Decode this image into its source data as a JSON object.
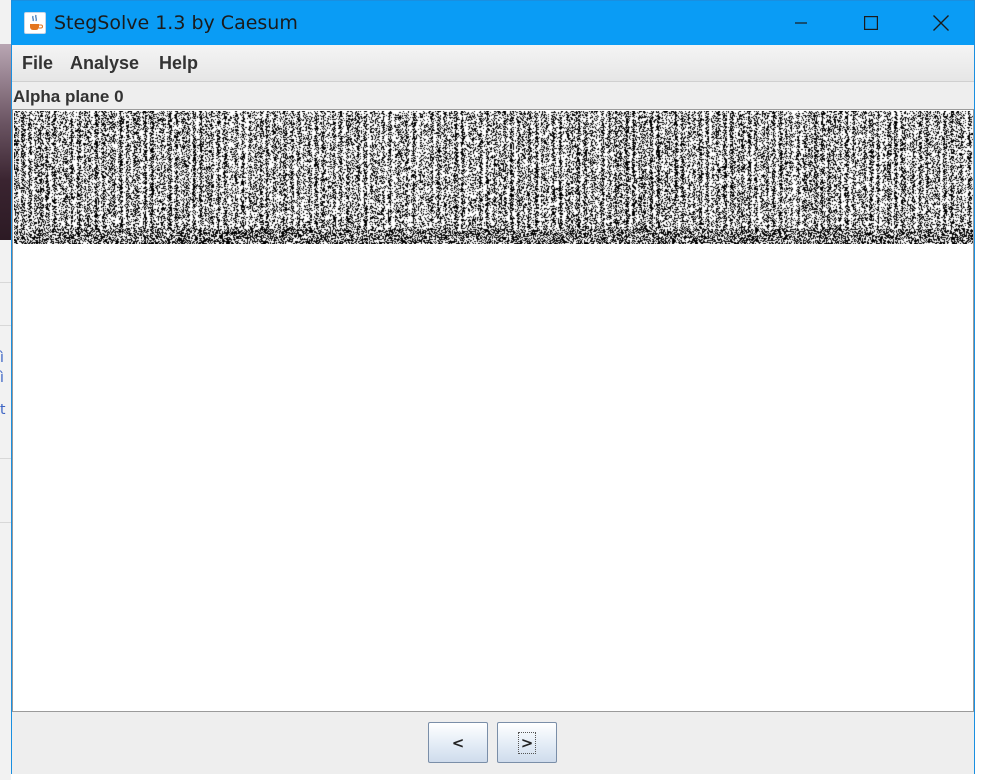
{
  "window": {
    "title": "StegSolve 1.3 by Caesum",
    "icon": "java-cup-icon",
    "controls": [
      "minimize-icon",
      "maximize-icon",
      "close-icon"
    ]
  },
  "menu": {
    "items": [
      {
        "label": "File"
      },
      {
        "label": "Analyse"
      },
      {
        "label": "Help"
      }
    ]
  },
  "view": {
    "plane_label": "Alpha plane 0"
  },
  "navigation": {
    "prev_label": "<",
    "next_label": ">"
  },
  "colors": {
    "titlebar": "#0a9cf5",
    "window_bg": "#eeeeee",
    "panel_bg": "#ffffff",
    "noise_fg": "#000000"
  }
}
